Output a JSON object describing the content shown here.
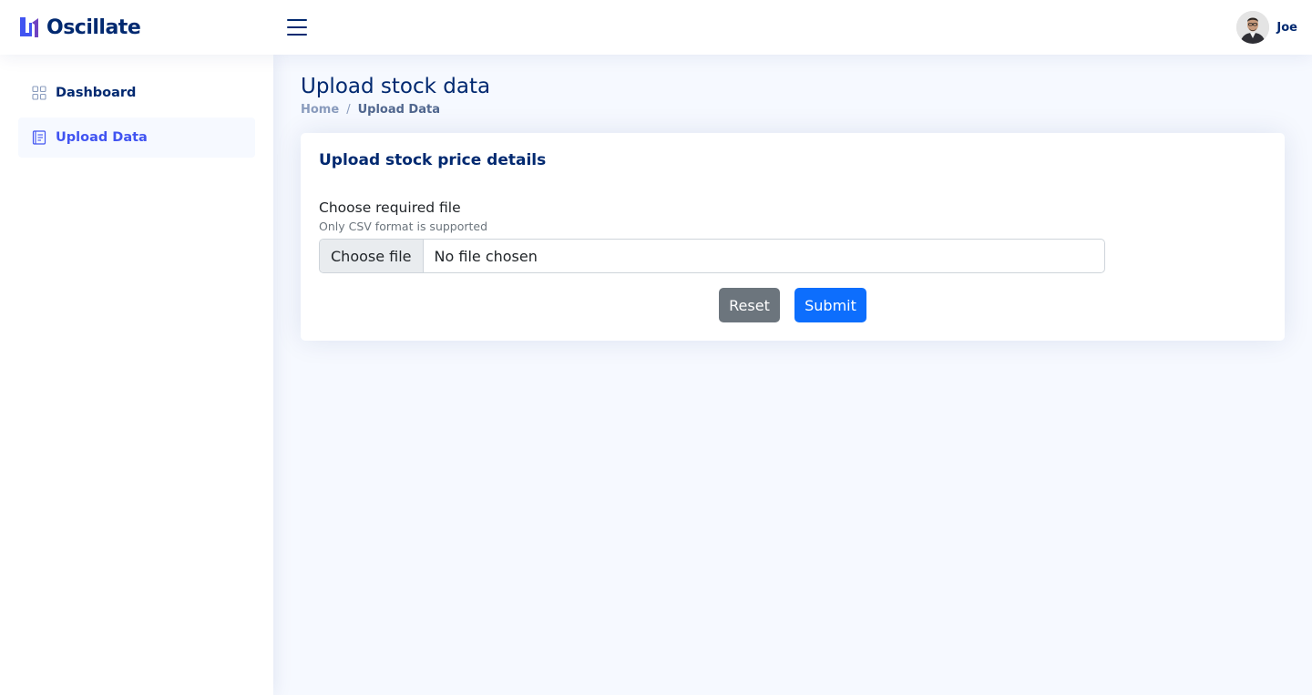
{
  "header": {
    "brand": "Oscillate",
    "user_name": "Joe"
  },
  "sidebar": {
    "items": [
      {
        "label": "Dashboard",
        "icon": "grid-icon",
        "active": false
      },
      {
        "label": "Upload Data",
        "icon": "journal-text-icon",
        "active": true
      }
    ]
  },
  "main": {
    "page_title": "Upload stock data",
    "breadcrumb": {
      "home": "Home",
      "separator": "/",
      "current": "Upload Data"
    },
    "card": {
      "title": "Upload stock price details",
      "field_label": "Choose required file",
      "field_help": "Only CSV format is supported",
      "file_button": "Choose file",
      "file_status": "No file chosen",
      "reset_label": "Reset",
      "submit_label": "Submit"
    }
  },
  "colors": {
    "brand": "#012970",
    "accent": "#4154f1",
    "primary_button": "#0d6efd",
    "secondary_button": "#6c757d",
    "page_bg": "#f6f9ff"
  }
}
